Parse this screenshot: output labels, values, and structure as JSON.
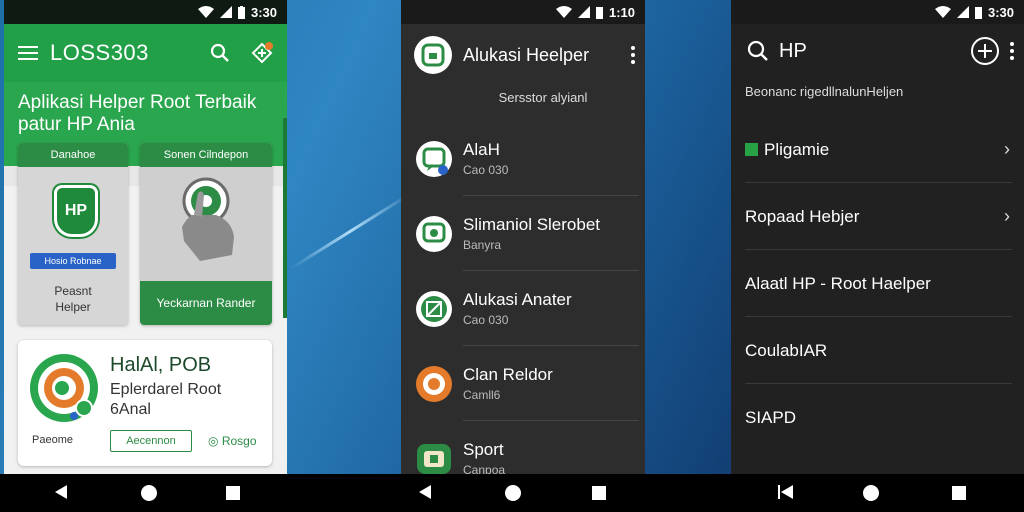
{
  "phones": [
    {
      "status_time": "3:30",
      "appbar": {
        "title": "LOSS303"
      },
      "hero": {
        "line1": "Aplikasi Helper Root Terbaik",
        "line2": "patur HP Ania"
      },
      "card1": {
        "header": "Danahoe",
        "badge_text": "HP",
        "blue_badge": "Hosio Robnae",
        "label_line1": "Peasnt",
        "label_line2": "Helper"
      },
      "card2": {
        "header": "Sonen Cilndepon",
        "bottom_label": "Yeckarnan Rander"
      },
      "bigcard": {
        "title": "HalAl, POB",
        "sub_line1": "Eplerdarel Root",
        "sub_line2": "6Anal",
        "foot_left": "Paeome",
        "button": "Aecennon",
        "foot_right": "Rosgo"
      }
    },
    {
      "status_time": "1:10",
      "header": {
        "title": "Alukasi Heelper"
      },
      "subheader": "Sersstor alyianl",
      "rows": [
        {
          "title": "AlaH",
          "sub": "Cao 030",
          "icon": "chat-app-icon"
        },
        {
          "title": "Slimaniol Slerobet",
          "sub": "Banyra",
          "icon": "chat-bubble-icon"
        },
        {
          "title": "Alukasi Anater",
          "sub": "Cao 030",
          "icon": "tools-icon"
        },
        {
          "title": "Clan Reldor",
          "sub": "Camll6",
          "icon": "orange-ring-icon"
        },
        {
          "title": "Sport",
          "sub": "Canpoa",
          "icon": "box-icon"
        }
      ]
    },
    {
      "status_time": "3:30",
      "header": {
        "title": "HP"
      },
      "subheader": "Beonanc rigedllnalunHeljen",
      "rows": [
        {
          "title": "Pligamie",
          "chevron": true,
          "marker": true
        },
        {
          "title": "Ropaad Hebjer",
          "chevron": true
        },
        {
          "title": "Alaatl HP - Root Haelper",
          "chevron": false
        },
        {
          "title": "CoulabIAR",
          "chevron": false
        },
        {
          "title": "SIAPD",
          "chevron": false
        }
      ]
    }
  ],
  "colors": {
    "green": "#22a047",
    "dark_green": "#2c8c45",
    "dark_bg": "#2d2d2d",
    "accent_orange": "#e37b2a"
  }
}
